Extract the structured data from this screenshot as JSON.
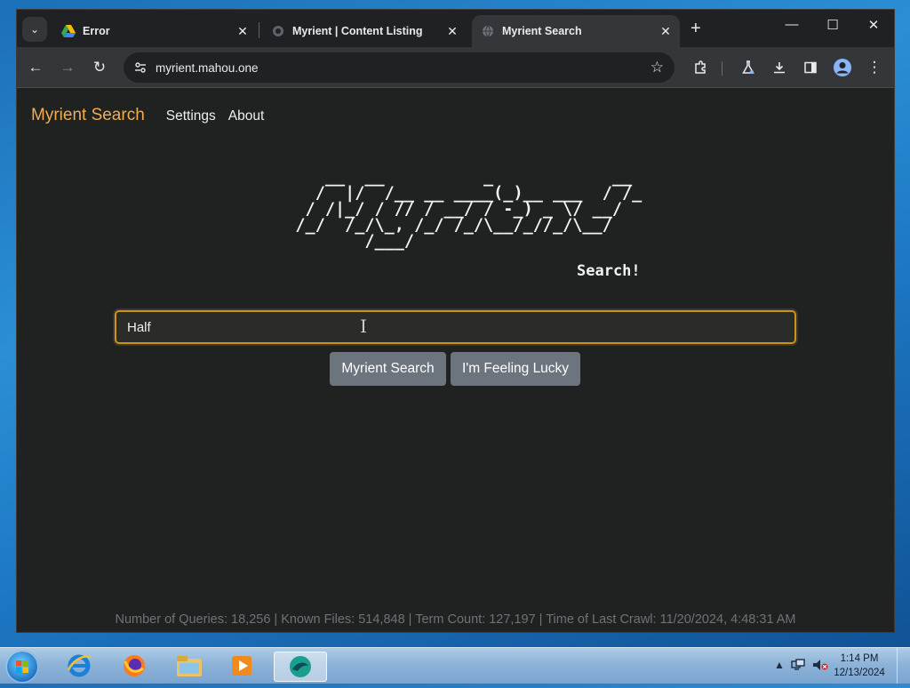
{
  "browser": {
    "tabs": [
      {
        "title": "Error",
        "favicon": "google-drive-icon",
        "active": false
      },
      {
        "title": "Myrient | Content Listing",
        "favicon": "myrient-icon",
        "active": false
      },
      {
        "title": "Myrient Search",
        "favicon": "globe-icon",
        "active": true
      }
    ],
    "url": "myrient.mahou.one"
  },
  "page": {
    "brand": "Myrient Search",
    "nav": {
      "settings": "Settings",
      "about": "About"
    },
    "ascii_logo": "      __  __          _            __ \n     /  |/  /__ __ ____(_)__ ___  / /_\n    / /|_/ / // / __/ / -_) _ \\/ __/\n   /_/  /_/\\_, /_/ /_/\\__/_//_/\\__/ \n          /___/                     ",
    "ascii_sub": "Search!",
    "search": {
      "value": "Half"
    },
    "buttons": {
      "search": "Myrient Search",
      "lucky": "I'm Feeling Lucky"
    },
    "stats": "Number of Queries: 18,256 | Known Files: 514,848 | Term Count: 127,197 | Time of Last Crawl: 11/20/2024, 4:48:31 AM"
  },
  "taskbar": {
    "clock_time": "1:14 PM",
    "clock_date": "12/13/2024"
  }
}
